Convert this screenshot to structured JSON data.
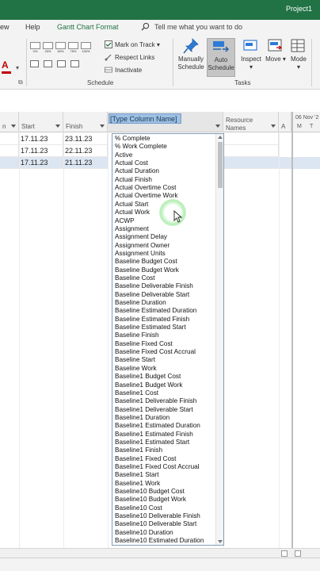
{
  "window": {
    "app_name": "Project1",
    "titlebar_color": "#217346"
  },
  "ribbon_tabs": {
    "view": "ew",
    "help": "Help",
    "gantt_format": "Gantt Chart Format"
  },
  "tell_me": {
    "text": "Tell me what you want to do"
  },
  "ribbon": {
    "percent_buttons": [
      "0%",
      "25%",
      "50%",
      "75%",
      "100%"
    ],
    "mark_on_track": "Mark on Track",
    "respect_links": "Respect Links",
    "inactivate": "Inactivate",
    "schedule_group": "Schedule",
    "manually_schedule": [
      "Manually",
      "Schedule"
    ],
    "auto_schedule": [
      "Auto",
      "Schedule"
    ],
    "inspect": "Inspect",
    "move": "Move",
    "mode": "Mode",
    "tasks_group": "Tasks"
  },
  "columns": {
    "duration_partial": "n",
    "start": "Start",
    "finish": "Finish",
    "new_column_input": "[Type Column Name]",
    "resource_names": [
      "Resource",
      "Names"
    ],
    "add_column": "A"
  },
  "rows": [
    {
      "start": "17.11.23",
      "finish": "23.11.23",
      "selected": false
    },
    {
      "start": "17.11.23",
      "finish": "22.11.23",
      "selected": false
    },
    {
      "start": "17.11.23",
      "finish": "21.11.23",
      "selected": true
    }
  ],
  "timeline": {
    "week_label": "06 Nov '2",
    "days": [
      "M",
      "T"
    ]
  },
  "field_list": [
    "% Complete",
    "% Work Complete",
    "Active",
    "Actual Cost",
    "Actual Duration",
    "Actual Finish",
    "Actual Overtime Cost",
    "Actual Overtime Work",
    "Actual Start",
    "Actual Work",
    "ACWP",
    "Assignment",
    "Assignment Delay",
    "Assignment Owner",
    "Assignment Units",
    "Baseline Budget Cost",
    "Baseline Budget Work",
    "Baseline Cost",
    "Baseline Deliverable Finish",
    "Baseline Deliverable Start",
    "Baseline Duration",
    "Baseline Estimated Duration",
    "Baseline Estimated Finish",
    "Baseline Estimated Start",
    "Baseline Finish",
    "Baseline Fixed Cost",
    "Baseline Fixed Cost Accrual",
    "Baseline Start",
    "Baseline Work",
    "Baseline1 Budget Cost",
    "Baseline1 Budget Work",
    "Baseline1 Cost",
    "Baseline1 Deliverable Finish",
    "Baseline1 Deliverable Start",
    "Baseline1 Duration",
    "Baseline1 Estimated Duration",
    "Baseline1 Estimated Finish",
    "Baseline1 Estimated Start",
    "Baseline1 Finish",
    "Baseline1 Fixed Cost",
    "Baseline1 Fixed Cost Accrual",
    "Baseline1 Start",
    "Baseline1 Work",
    "Baseline10 Budget Cost",
    "Baseline10 Budget Work",
    "Baseline10 Cost",
    "Baseline10 Deliverable Finish",
    "Baseline10 Deliverable Start",
    "Baseline10 Duration",
    "Baseline10 Estimated Duration"
  ]
}
